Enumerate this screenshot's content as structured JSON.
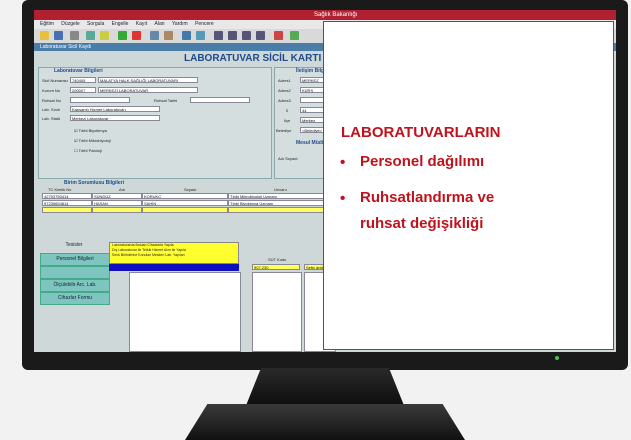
{
  "app": {
    "window_title": "Sağlık Bakanlığı",
    "menu": [
      "Eğitim",
      "Düzgele",
      "Sorgula",
      "Engelle",
      "Kayıt",
      "Alan",
      "Yardım",
      "Pencere"
    ],
    "subtitle": "Laboratuvar Sicil Kaydı",
    "form_title": "LABORATUVAR SİCİL KARTI"
  },
  "lab_info": {
    "title": "Laboratuvar Bilgileri",
    "sicil_label": "Sicil Numarası",
    "sicil_value": "740405",
    "sicil_name": "MALATYA HALK SAĞLIĞI LABORATUVARI",
    "kurum_label": "Kurum No",
    "kurum_value": "200007",
    "kurum_name": "MERKEZİ LABORATUVAR",
    "ruhsat_label": "Ruhsat No",
    "ruhsat_tarihi_label": "Ruhsat Tarihi",
    "lab_sinifi_label": "Lab. Sınıfı",
    "lab_sinifi_value": "Kapsamlı Hizmet Laboratuvarı",
    "lab_statu_label": "Lab. Statü",
    "lab_statu_value": "Merkezi Laboratuvar",
    "checkboxes": [
      "Tıbbi Biyokimya",
      "Tıbbi Mikrobiyoloji",
      "Tıbbi Patoloji"
    ]
  },
  "contact_info": {
    "title": "İletişim Bilgileri",
    "labels": [
      "Adres1",
      "Adres2",
      "Adres3",
      "İl",
      "İlçe",
      "Belediye"
    ],
    "values": [
      "MERKEZ",
      "KÜRŞ",
      "",
      "44",
      "Merkez",
      "<Belediye>"
    ],
    "hizmet_title": "Mesul Müdür",
    "adi_soyadi_label": "Adı Soyadı"
  },
  "staff": {
    "title": "Birim Sorumlusu Bilgileri",
    "headers": [
      "TC Kimlik No",
      "Adı",
      "Soyadı",
      "Unvanı"
    ],
    "rows": [
      [
        "42753750414",
        "SÜNDÜZ",
        "KORUKÇ",
        "Tıbbi Mikrobiyoloji Uzmanı"
      ],
      [
        "97239654814",
        "HASAN",
        "ŞAHİN",
        "Tıbbi Biyokimya Uzmanı"
      ]
    ]
  },
  "side": {
    "heading": "Tesisler",
    "buttons": [
      "Personel Bilgileri",
      "",
      "Ölçülebilir Arc. Lab.",
      "Cihazlar Formu"
    ]
  },
  "notes_lines": [
    "Laboratuvarda Buluan Cihazlarla Yapıla",
    "Dış Laboratuvar ile Tetkik Hizmet Alım ile Yapıla",
    "Sevk Birimlerine Konulan Mesken Lab. Yapılan"
  ],
  "grid": {
    "sut_label": "SUT Kodu",
    "sut_value": "907.230",
    "name_value": "Sefix antijeni"
  },
  "card": {
    "title": "LABORATUVARLARIN",
    "bullets": [
      "Personel dağılımı",
      "Ruhsatlandırma ve",
      "ruhsat değişikliği"
    ],
    "bullet_char": "•",
    "accent": "#c0121c"
  }
}
